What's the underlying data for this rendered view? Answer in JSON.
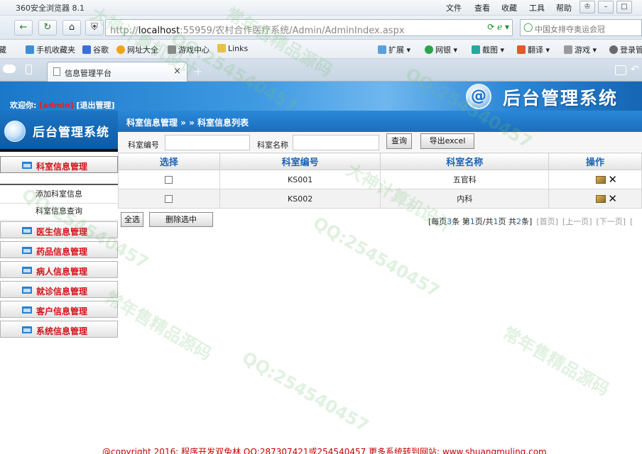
{
  "browser": {
    "app_title": "360安全浏览器 8.1",
    "menu": [
      "文件",
      "查看",
      "收藏",
      "工具",
      "帮助"
    ],
    "url_scheme": "http://",
    "url_host": "localhost",
    "url_path": ":55959/农村合作医疗系统/Admin/AdminIndex.aspx",
    "search_text": "中国女排夺奥运会冠",
    "favorites": [
      "藏",
      "手机收藏夹",
      "谷歌",
      "网址大全",
      "游戏中心",
      "Links",
      "扩展",
      "网银",
      "截图",
      "翻译",
      "游戏",
      "登录管"
    ],
    "tab_title": "信息管理平台",
    "tab_close": "×",
    "new_tab": "+"
  },
  "header": {
    "welcome_prefix": "欢迎你:",
    "user": "[admin]",
    "logout": "[退出管理]",
    "logo_glyph": "@",
    "title": "后台管理系统"
  },
  "sidebar": {
    "logo_text": "后台管理系统",
    "active_menu": "科室信息管理",
    "sub_items": [
      "添加科室信息",
      "科室信息查询"
    ],
    "menus": [
      "医生信息管理",
      "药品信息管理",
      "病人信息管理",
      "就诊信息管理",
      "客户信息管理",
      "系统信息管理"
    ]
  },
  "breadcrumb": "科室信息管理 » » 科室信息列表",
  "search": {
    "code_label": "科室编号",
    "name_label": "科室名称",
    "code_value": "",
    "name_value": "",
    "query_button": "查询",
    "export_button": "导出excel"
  },
  "table": {
    "headers": [
      "选择",
      "科室编号",
      "科室名称",
      "操作"
    ],
    "rows": [
      {
        "code": "KS001",
        "name": "五官科"
      },
      {
        "code": "KS002",
        "name": "内科"
      }
    ]
  },
  "actions": {
    "select_all": "全选",
    "delete_selected": "删除选中"
  },
  "pager": {
    "t1": "[每页",
    "per_page": "3",
    "t2": "条 第",
    "current": "1",
    "t3": "页/共",
    "total_pages": "1",
    "t4": "页 共",
    "total": "2",
    "t5": "条]",
    "first": "[首页]",
    "prev": "[上一页]",
    "next": "[下一页]",
    "last": "["
  },
  "copyright": "@copyright 2016: 程序开发双兔林  QQ:287307421或254540457  更多系统转到网站: www.shuangmuling.com",
  "watermarks": [
    "大神计算机设计",
    "QQ:254540457",
    "常年售精品源码",
    "QQ:254540457",
    "大神计算机设计",
    "QQ:254540457",
    "常年售精品源码",
    "QQ:254540457",
    "常年售精品源码",
    "QQ:254540457"
  ]
}
